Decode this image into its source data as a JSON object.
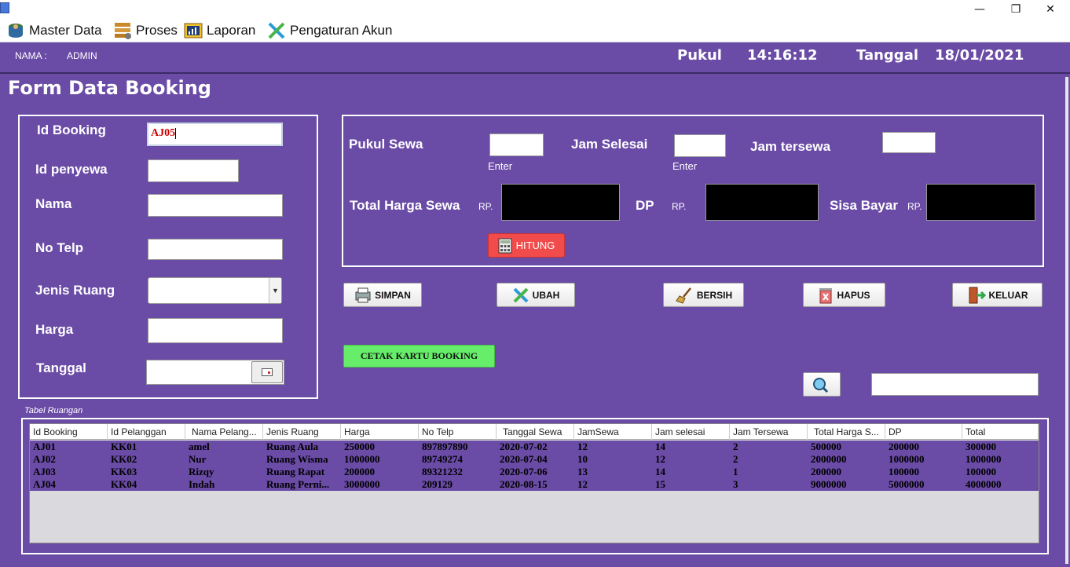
{
  "window": {
    "controls": [
      "—",
      "❐",
      "✕"
    ]
  },
  "menu": [
    {
      "label": "Master Data",
      "icon": "database-user-icon"
    },
    {
      "label": "Proses",
      "icon": "process-icon"
    },
    {
      "label": "Laporan",
      "icon": "report-icon"
    },
    {
      "label": "Pengaturan Akun",
      "icon": "settings-tools-icon"
    }
  ],
  "info": {
    "nama_label": "NAMA  :",
    "nama_value": "ADMIN",
    "pukul_label": "Pukul",
    "time": "14:16:12",
    "tanggal_label": "Tanggal",
    "date": "18/01/2021"
  },
  "form": {
    "title": "Form Data Booking",
    "id_booking_label": "Id Booking",
    "id_booking_value": "AJ05",
    "id_penyewa_label": "Id penyewa",
    "nama_label": "Nama",
    "no_telp_label": "No Telp",
    "jenis_ruang_label": "Jenis Ruang",
    "harga_label": "Harga",
    "tanggal_label": "Tanggal"
  },
  "sewa": {
    "pukul_sewa_label": "Pukul Sewa",
    "jam_selesai_label": "Jam Selesai",
    "jam_tersewa_label": "Jam tersewa",
    "enter_hint": "Enter",
    "total_harga_label": "Total Harga Sewa",
    "dp_label": "DP",
    "sisa_bayar_label": "Sisa Bayar",
    "rp": "RP.",
    "hitung_label": "HITUNG"
  },
  "actions": {
    "simpan": "SIMPAN",
    "ubah": "UBAH",
    "bersih": "BERSIH",
    "hapus": "HAPUS",
    "keluar": "KELUAR",
    "cetak": "CETAK KARTU BOOKING"
  },
  "table": {
    "caption": "Tabel Ruangan",
    "columns": [
      "Id Booking",
      "Id Pelanggan",
      "Nama Pelang...",
      "Jenis Ruang",
      "Harga",
      "No Telp",
      "Tanggal Sewa",
      "JamSewa",
      "Jam selesai",
      "Jam Tersewa",
      "Total Harga S...",
      "DP",
      "Total"
    ],
    "rows": [
      [
        "AJ01",
        "KK01",
        "amel",
        "Ruang Aula",
        "250000",
        "897897890",
        "2020-07-02",
        "12",
        "14",
        "2",
        "500000",
        "200000",
        "300000"
      ],
      [
        "AJ02",
        "KK02",
        "Nur",
        "Ruang Wisma",
        "1000000",
        "89749274",
        "2020-07-04",
        "10",
        "12",
        "2",
        "2000000",
        "1000000",
        "1000000"
      ],
      [
        "AJ03",
        "KK03",
        "Rizqy",
        "Ruang Rapat",
        "200000",
        "89321232",
        "2020-07-06",
        "13",
        "14",
        "1",
        "200000",
        "100000",
        "100000"
      ],
      [
        "AJ04",
        "KK04",
        "Indah",
        "Ruang Perni...",
        "3000000",
        "209129",
        "2020-08-15",
        "12",
        "15",
        "3",
        "9000000",
        "5000000",
        "4000000"
      ]
    ]
  },
  "colors": {
    "background": "#6a4ba6",
    "hitung": "#f24b4b",
    "cetak": "#66ee6a"
  }
}
